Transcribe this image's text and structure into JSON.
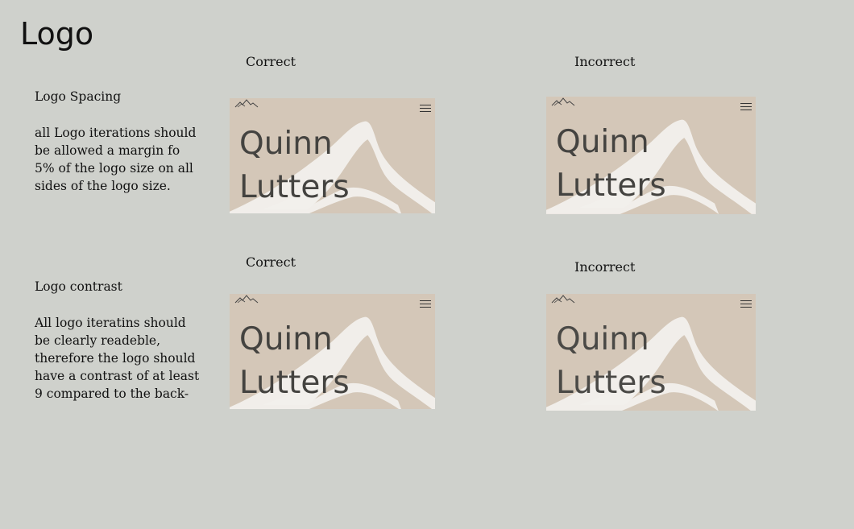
{
  "page": {
    "title": "Logo"
  },
  "sections": [
    {
      "heading": "Logo Spacing",
      "body": [
        "all Logo iterations should",
        "be allowed a margin fo",
        "5% of the logo size on all",
        "sides of  the logo size."
      ],
      "correct_label": "Correct",
      "incorrect_label": "Incorrect"
    },
    {
      "heading": "Logo contrast",
      "body": [
        "All logo iteratins should",
        "be clearly readeble,",
        "therefore the logo should",
        "have a contrast of at least",
        "9 compared to the back-"
      ],
      "correct_label": "Correct",
      "incorrect_label": "Incorrect"
    }
  ],
  "logo": {
    "name": "Quinn\nLutters",
    "mark_icon": "mountain-outline-icon",
    "menu_icon": "hamburger-menu-icon",
    "colors": {
      "card_bg": "#d4c7b8",
      "mountain": "#f2f0ec",
      "text": "#444340"
    }
  }
}
